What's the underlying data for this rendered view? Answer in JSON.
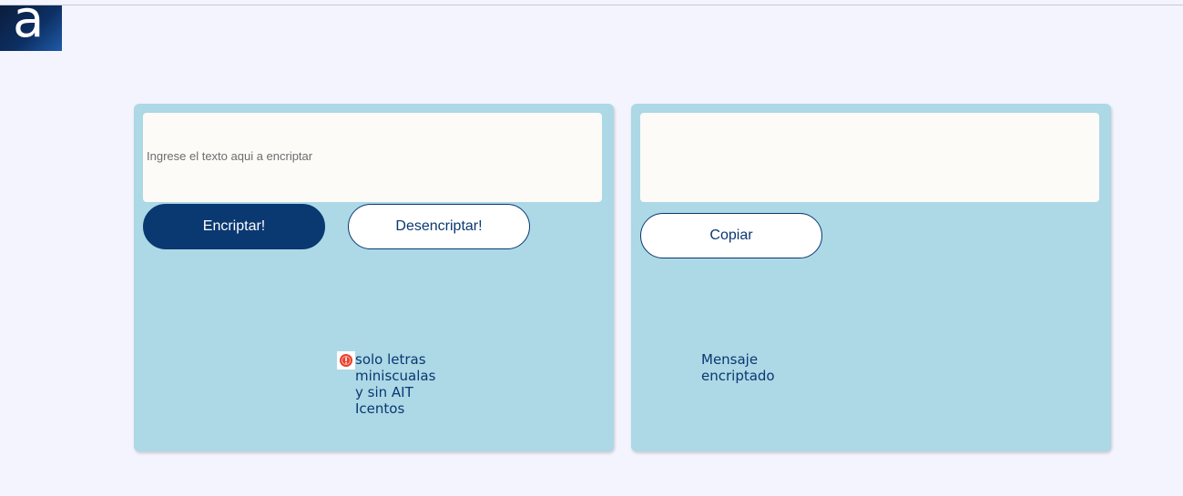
{
  "logo": {
    "letter": "a",
    "icon": "alura-logo-icon"
  },
  "encrypt_panel": {
    "input_placeholder": "Ingrese el texto aqui a encriptar",
    "input_value": "",
    "encrypt_button_label": "Encriptar!",
    "decrypt_button_label": "Desencriptar!",
    "warning_icon": "warning-icon",
    "warning_text": "solo letras miniscualas y sin AIT Icentos"
  },
  "output_panel": {
    "output_value": "",
    "copy_button_label": "Copiar",
    "message_text": "Mensaje encriptado"
  },
  "colors": {
    "page_background": "#f3f4fe",
    "panel_background": "#add8e6",
    "primary": "#0a3871",
    "textbox_background": "#fcfbf8",
    "warning_icon": "#e8402c"
  }
}
